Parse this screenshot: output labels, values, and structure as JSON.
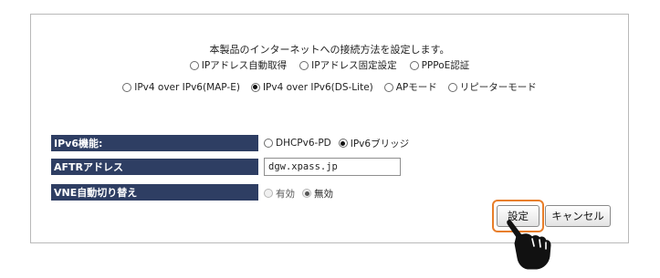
{
  "intro_text": "本製品のインターネットへの接続方法を設定します。",
  "connection_modes_row1": [
    {
      "label": "IPアドレス自動取得",
      "checked": false
    },
    {
      "label": "IPアドレス固定設定",
      "checked": false
    },
    {
      "label": "PPPoE認証",
      "checked": false
    }
  ],
  "connection_modes_row2": [
    {
      "label": "IPv4 over IPv6(MAP-E)",
      "checked": false
    },
    {
      "label": "IPv4 over IPv6(DS-Lite)",
      "checked": true
    },
    {
      "label": "APモード",
      "checked": false
    },
    {
      "label": "リピーターモード",
      "checked": false
    }
  ],
  "ipv6_function": {
    "label": "IPv6機能:",
    "options": [
      {
        "label": "DHCPv6-PD",
        "checked": false
      },
      {
        "label": "IPv6ブリッジ",
        "checked": true
      }
    ]
  },
  "aftr": {
    "label": "AFTRアドレス",
    "value": "dgw.xpass.jp"
  },
  "vne_switch": {
    "label": "VNE自動切り替え",
    "options": [
      {
        "label": "有効",
        "checked": false
      },
      {
        "label": "無効",
        "checked": true
      }
    ]
  },
  "buttons": {
    "save_label": "設定",
    "cancel_label": "キャンセル"
  },
  "colors": {
    "label_bg": "#2e3e63",
    "highlight": "#e87e2a"
  },
  "icons": {
    "pointer": "pointing-hand-icon"
  }
}
